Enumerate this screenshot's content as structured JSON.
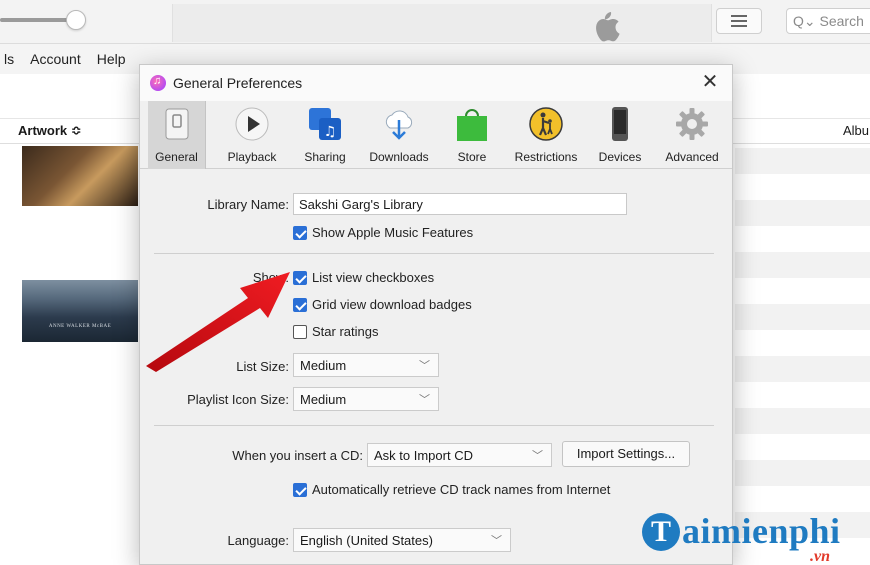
{
  "itunes": {
    "search_placeholder": "Search",
    "menu": [
      "ls",
      "Account",
      "Help"
    ],
    "columns": {
      "artwork": "Artwork ≎",
      "album": "Albu"
    },
    "album2_caption": "ANNE WALKER McBAE"
  },
  "dialog": {
    "title": "General Preferences",
    "close_glyph": "✕",
    "tabs": [
      {
        "label": "General",
        "icon": "general-switch-icon",
        "active": true
      },
      {
        "label": "Playback",
        "icon": "play-icon"
      },
      {
        "label": "Sharing",
        "icon": "sharing-music-icon"
      },
      {
        "label": "Downloads",
        "icon": "download-cloud-icon"
      },
      {
        "label": "Store",
        "icon": "store-bag-icon"
      },
      {
        "label": "Restrictions",
        "icon": "parental-restrictions-icon"
      },
      {
        "label": "Devices",
        "icon": "device-phone-icon"
      },
      {
        "label": "Advanced",
        "icon": "gear-icon"
      }
    ],
    "library_name_label": "Library Name:",
    "library_name_value": "Sakshi Garg's Library",
    "show_apple_music": {
      "label": "Show Apple Music Features",
      "checked": true
    },
    "show_label": "Show:",
    "show_options": [
      {
        "label": "List view checkboxes",
        "checked": true
      },
      {
        "label": "Grid view download badges",
        "checked": true
      },
      {
        "label": "Star ratings",
        "checked": false
      }
    ],
    "list_size_label": "List Size:",
    "list_size_value": "Medium",
    "playlist_icon_size_label": "Playlist Icon Size:",
    "playlist_icon_size_value": "Medium",
    "insert_cd_label": "When you insert a CD:",
    "insert_cd_value": "Ask to Import CD",
    "import_settings_button": "Import Settings...",
    "auto_retrieve": {
      "label": "Automatically retrieve CD track names from Internet",
      "checked": true
    },
    "language_label": "Language:",
    "language_value": "English (United States)"
  },
  "watermark": {
    "letter": "T",
    "text": "aimienphi",
    "suffix": ".vn"
  },
  "colors": {
    "accent": "#2a6fd6",
    "arrow": "#e8141b",
    "watermark": "#1f7bc1"
  }
}
